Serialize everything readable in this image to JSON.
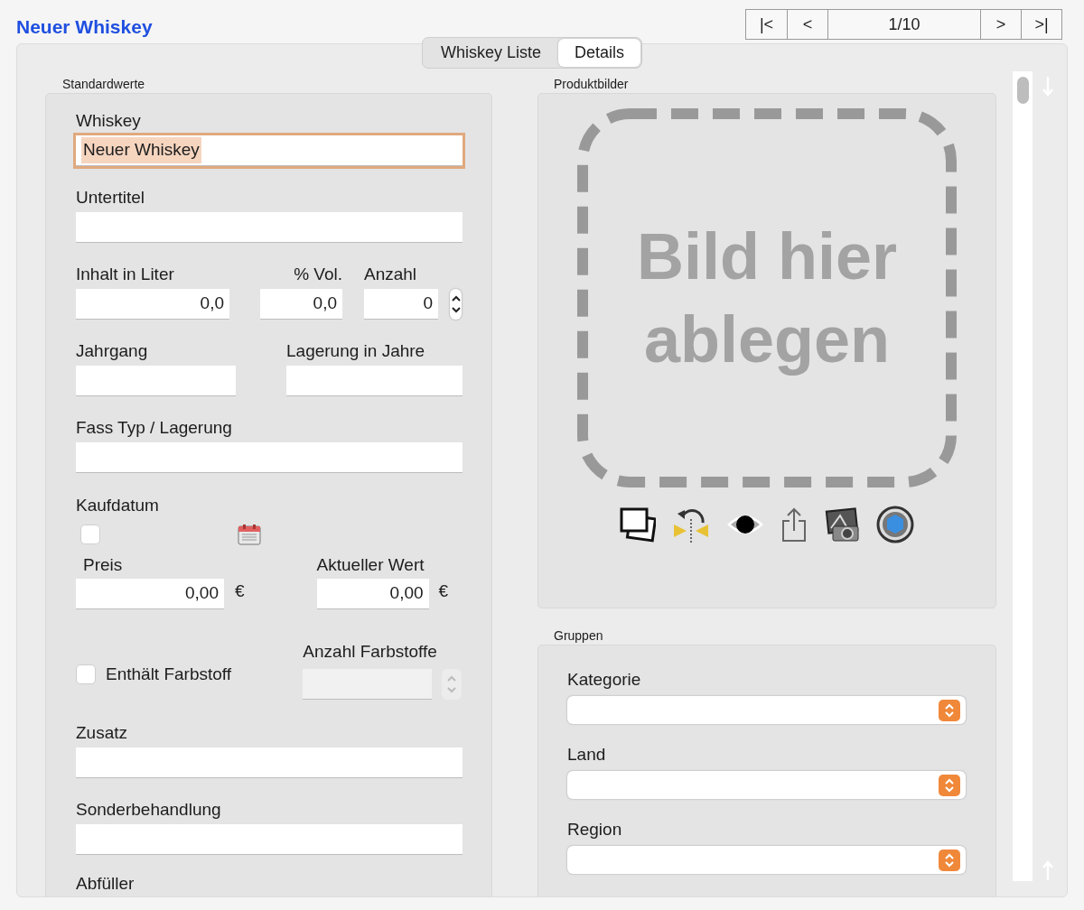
{
  "title": "Neuer Whiskey",
  "pager": {
    "first": "|<",
    "prev": "<",
    "position": "1/10",
    "next": ">",
    "last": ">|"
  },
  "tabs": [
    {
      "label": "Whiskey Liste",
      "selected": false
    },
    {
      "label": "Details",
      "selected": true
    }
  ],
  "standard": {
    "title": "Standardwerte",
    "whiskey": {
      "label": "Whiskey",
      "value": "Neuer Whiskey",
      "focused": true
    },
    "untertitel": {
      "label": "Untertitel",
      "focused": false
    },
    "inhalt": {
      "label": "Inhalt in Liter",
      "value": "0,0"
    },
    "vol": {
      "label": "% Vol.",
      "value": "0,0"
    },
    "anzahl": {
      "label": "Anzahl",
      "value": "0"
    },
    "jahrgang": {
      "label": "Jahrgang"
    },
    "lagerung": {
      "label": "Lagerung in Jahre"
    },
    "fass": {
      "label": "Fass Typ / Lagerung",
      "focused": false
    },
    "kaufdatum": {
      "label": "Kaufdatum",
      "checked": false
    },
    "preis": {
      "label": "Preis",
      "value": "0,00",
      "currency": "€"
    },
    "wert": {
      "label": "Aktueller Wert",
      "value": "0,00",
      "currency": "€"
    },
    "farbstoff": {
      "label": "Enthält Farbstoff",
      "checked": false
    },
    "anzahl_farbstoffe": {
      "label": "Anzahl Farbstoffe",
      "disabled": true
    },
    "zusatz": {
      "label": "Zusatz",
      "focused": false
    },
    "sonderbehandlung": {
      "label": "Sonderbehandlung",
      "focused": false
    },
    "abfueller": {
      "label": "Abfüller"
    }
  },
  "produktbilder": {
    "title": "Produktbilder",
    "drop_text": "Bild hier ablegen"
  },
  "gruppen": {
    "title": "Gruppen",
    "selects": [
      {
        "label": "Kategorie"
      },
      {
        "label": "Land"
      },
      {
        "label": "Region"
      }
    ]
  }
}
